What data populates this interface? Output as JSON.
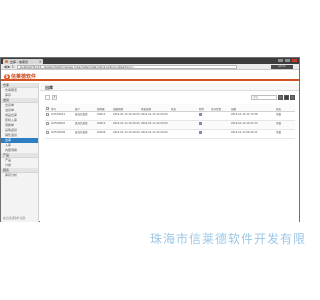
{
  "browser": {
    "tab_title": "出库 - 信莱德",
    "url": "localhost/?b=13... &page=&html=&view_type=list&model=stock.picking.out&action=...",
    "user_chip": "admin",
    "back": "◀",
    "forward": "▶",
    "reload": "↻"
  },
  "brand": {
    "mark": "S",
    "name": "信莱德软件"
  },
  "sidebar": {
    "sections": [
      {
        "label": "仓库",
        "items": [
          "仓库概览",
          "库存"
        ]
      },
      {
        "label": "发货",
        "items": [
          "出货单",
          "进货单",
          "成品出库",
          "原料入库",
          "调拨单",
          "采购退货",
          "销售退货",
          "出库",
          "入库",
          "内部调拨"
        ]
      },
      {
        "label": "产品",
        "items": [
          "产品",
          "分类"
        ]
      },
      {
        "label": "报表",
        "items": [
          "库存分析"
        ]
      }
    ],
    "active_item": "出库",
    "footer": "由 信莱德软件 提供"
  },
  "main": {
    "title": "出库",
    "search_placeholder": "搜索",
    "columns": [
      "单号",
      "客户",
      "源单据",
      "创建日期",
      "承诺日期",
      "状态",
      "附件",
      "库存位置",
      "创建",
      "状态"
    ],
    "rows": [
      [
        "OUT/00011",
        "珠海信莱德",
        "SO011",
        "2014-01-15 12:00:00",
        "2014-01-15 12:00:00",
        "",
        "",
        "",
        "2014-01-15 11:13:58",
        "草稿"
      ],
      [
        "OUT/00010",
        "珠海信莱德",
        "SO010",
        "2014-01-14 12:00:00",
        "2014-01-14 12:00:00",
        "",
        "",
        "",
        "2014-01-14 10:21:32",
        "草稿"
      ],
      [
        "OUT/00009",
        "珠海信莱德",
        "SO009",
        "2014-01-13 12:00:00",
        "2014-01-13 12:00:00",
        "",
        "",
        "",
        "2014-01-13 09:45:11",
        "草稿"
      ]
    ]
  },
  "watermark": "珠海市信莱德软件开发有限",
  "colors": {
    "brand": "#d0491c",
    "active": "#2d7fc2",
    "watermark": "#9cc7e6"
  },
  "icons": [
    "favicon-icon",
    "close-icon",
    "back-icon",
    "forward-icon",
    "reload-icon",
    "logo-icon",
    "document-icon",
    "checkbox-icon"
  ]
}
